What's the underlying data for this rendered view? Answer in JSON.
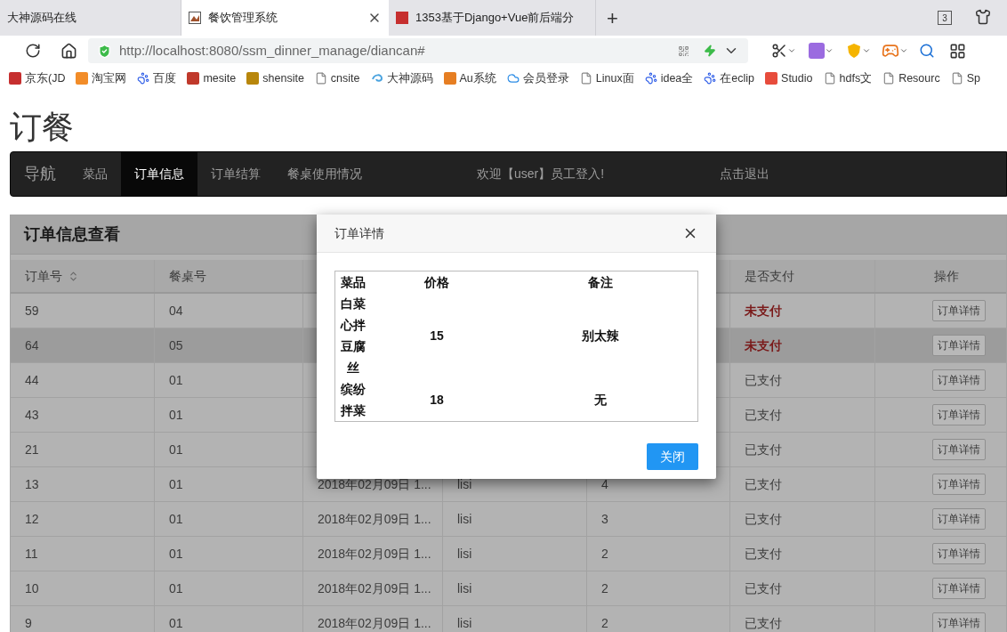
{
  "browser": {
    "tabs": [
      {
        "label": "大神源码在线",
        "selected": false,
        "kind": "plain"
      },
      {
        "label": "餐饮管理系统",
        "selected": true,
        "kind": "picture"
      },
      {
        "label": "1353基于Django+Vue前后端分",
        "selected": false,
        "kind": "square"
      }
    ],
    "new_tab": "+",
    "tab_count": "3",
    "url": "http://localhost:8080/ssm_dinner_manage/diancan#",
    "bookmarks": [
      {
        "label": "京东(JD",
        "kind": "square",
        "color": "#c62f2f"
      },
      {
        "label": "淘宝网",
        "kind": "square",
        "color": "#f28c28"
      },
      {
        "label": "百度",
        "kind": "paw"
      },
      {
        "label": "mesite",
        "kind": "square",
        "color": "#c0392b"
      },
      {
        "label": "shensite",
        "kind": "square",
        "color": "#b8860b"
      },
      {
        "label": "cnsite",
        "kind": "page"
      },
      {
        "label": "大神源码",
        "kind": "swirl"
      },
      {
        "label": "Au系统",
        "kind": "square",
        "color": "#e67e22"
      },
      {
        "label": "会员登录",
        "kind": "cloud"
      },
      {
        "label": "Linux面",
        "kind": "page"
      },
      {
        "label": "idea全",
        "kind": "paw"
      },
      {
        "label": "在eclip",
        "kind": "paw"
      },
      {
        "label": "Studio",
        "kind": "square",
        "color": "#e74c3c"
      },
      {
        "label": "hdfs文",
        "kind": "page"
      },
      {
        "label": "Resourc",
        "kind": "page"
      },
      {
        "label": "Sp",
        "kind": "page"
      }
    ]
  },
  "page_title": "订餐",
  "navbar": {
    "brand": "导航",
    "items": [
      {
        "label": "菜品",
        "selected": false
      },
      {
        "label": "订单信息",
        "selected": true
      },
      {
        "label": "订单结算",
        "selected": false
      },
      {
        "label": "餐桌使用情况",
        "selected": false
      }
    ],
    "welcome": "欢迎【user】员工登入!",
    "logout": "点击退出"
  },
  "panel": {
    "title": "订单信息查看",
    "columns": [
      {
        "label": "订单号",
        "sortable": true
      },
      {
        "label": "餐桌号",
        "sortable": false
      },
      null,
      null,
      null,
      {
        "label": "是否支付",
        "sortable": false
      },
      {
        "label": "操作",
        "sortable": false
      }
    ],
    "rows": [
      {
        "order": "59",
        "table": "04",
        "paid": false,
        "status": "未支付",
        "highlighted": false,
        "action": "订单详情"
      },
      {
        "order": "64",
        "table": "05",
        "paid": false,
        "status": "未支付",
        "highlighted": true,
        "action": "订单详情"
      },
      {
        "order": "44",
        "table": "01",
        "paid": true,
        "status": "已支付",
        "highlighted": false,
        "action": "订单详情"
      },
      {
        "order": "43",
        "table": "01",
        "paid": true,
        "status": "已支付",
        "highlighted": false,
        "action": "订单详情"
      },
      {
        "order": "21",
        "table": "01",
        "paid": true,
        "status": "已支付",
        "highlighted": false,
        "action": "订单详情"
      },
      {
        "order": "13",
        "table": "01",
        "column_3": "2018年02月09日 1...",
        "column_4": "lisi",
        "column_5": "4",
        "paid": true,
        "status": "已支付",
        "highlighted": false,
        "action": "订单详情"
      },
      {
        "order": "12",
        "table": "01",
        "column_3": "2018年02月09日 1...",
        "column_4": "lisi",
        "column_5": "3",
        "paid": true,
        "status": "已支付",
        "highlighted": false,
        "action": "订单详情"
      },
      {
        "order": "11",
        "table": "01",
        "column_3": "2018年02月09日 1...",
        "column_4": "lisi",
        "column_5": "2",
        "paid": true,
        "status": "已支付",
        "highlighted": false,
        "action": "订单详情"
      },
      {
        "order": "10",
        "table": "01",
        "column_3": "2018年02月09日 1...",
        "column_4": "lisi",
        "column_5": "2",
        "paid": true,
        "status": "已支付",
        "highlighted": false,
        "action": "订单详情"
      },
      {
        "order": "9",
        "table": "01",
        "column_3": "2018年02月09日 1...",
        "column_4": "lisi",
        "column_5": "2",
        "paid": true,
        "status": "已支付",
        "highlighted": false,
        "action": "订单详情"
      }
    ]
  },
  "modal": {
    "title": "订单详情",
    "columns": [
      "菜品",
      "价格",
      "备注"
    ],
    "rows": [
      {
        "dish": "白菜心拌豆腐丝",
        "price": "15",
        "note": "别太辣"
      },
      {
        "dish": "缤纷拌菜",
        "price": "18",
        "note": "无"
      }
    ],
    "close_button": "关闭"
  }
}
